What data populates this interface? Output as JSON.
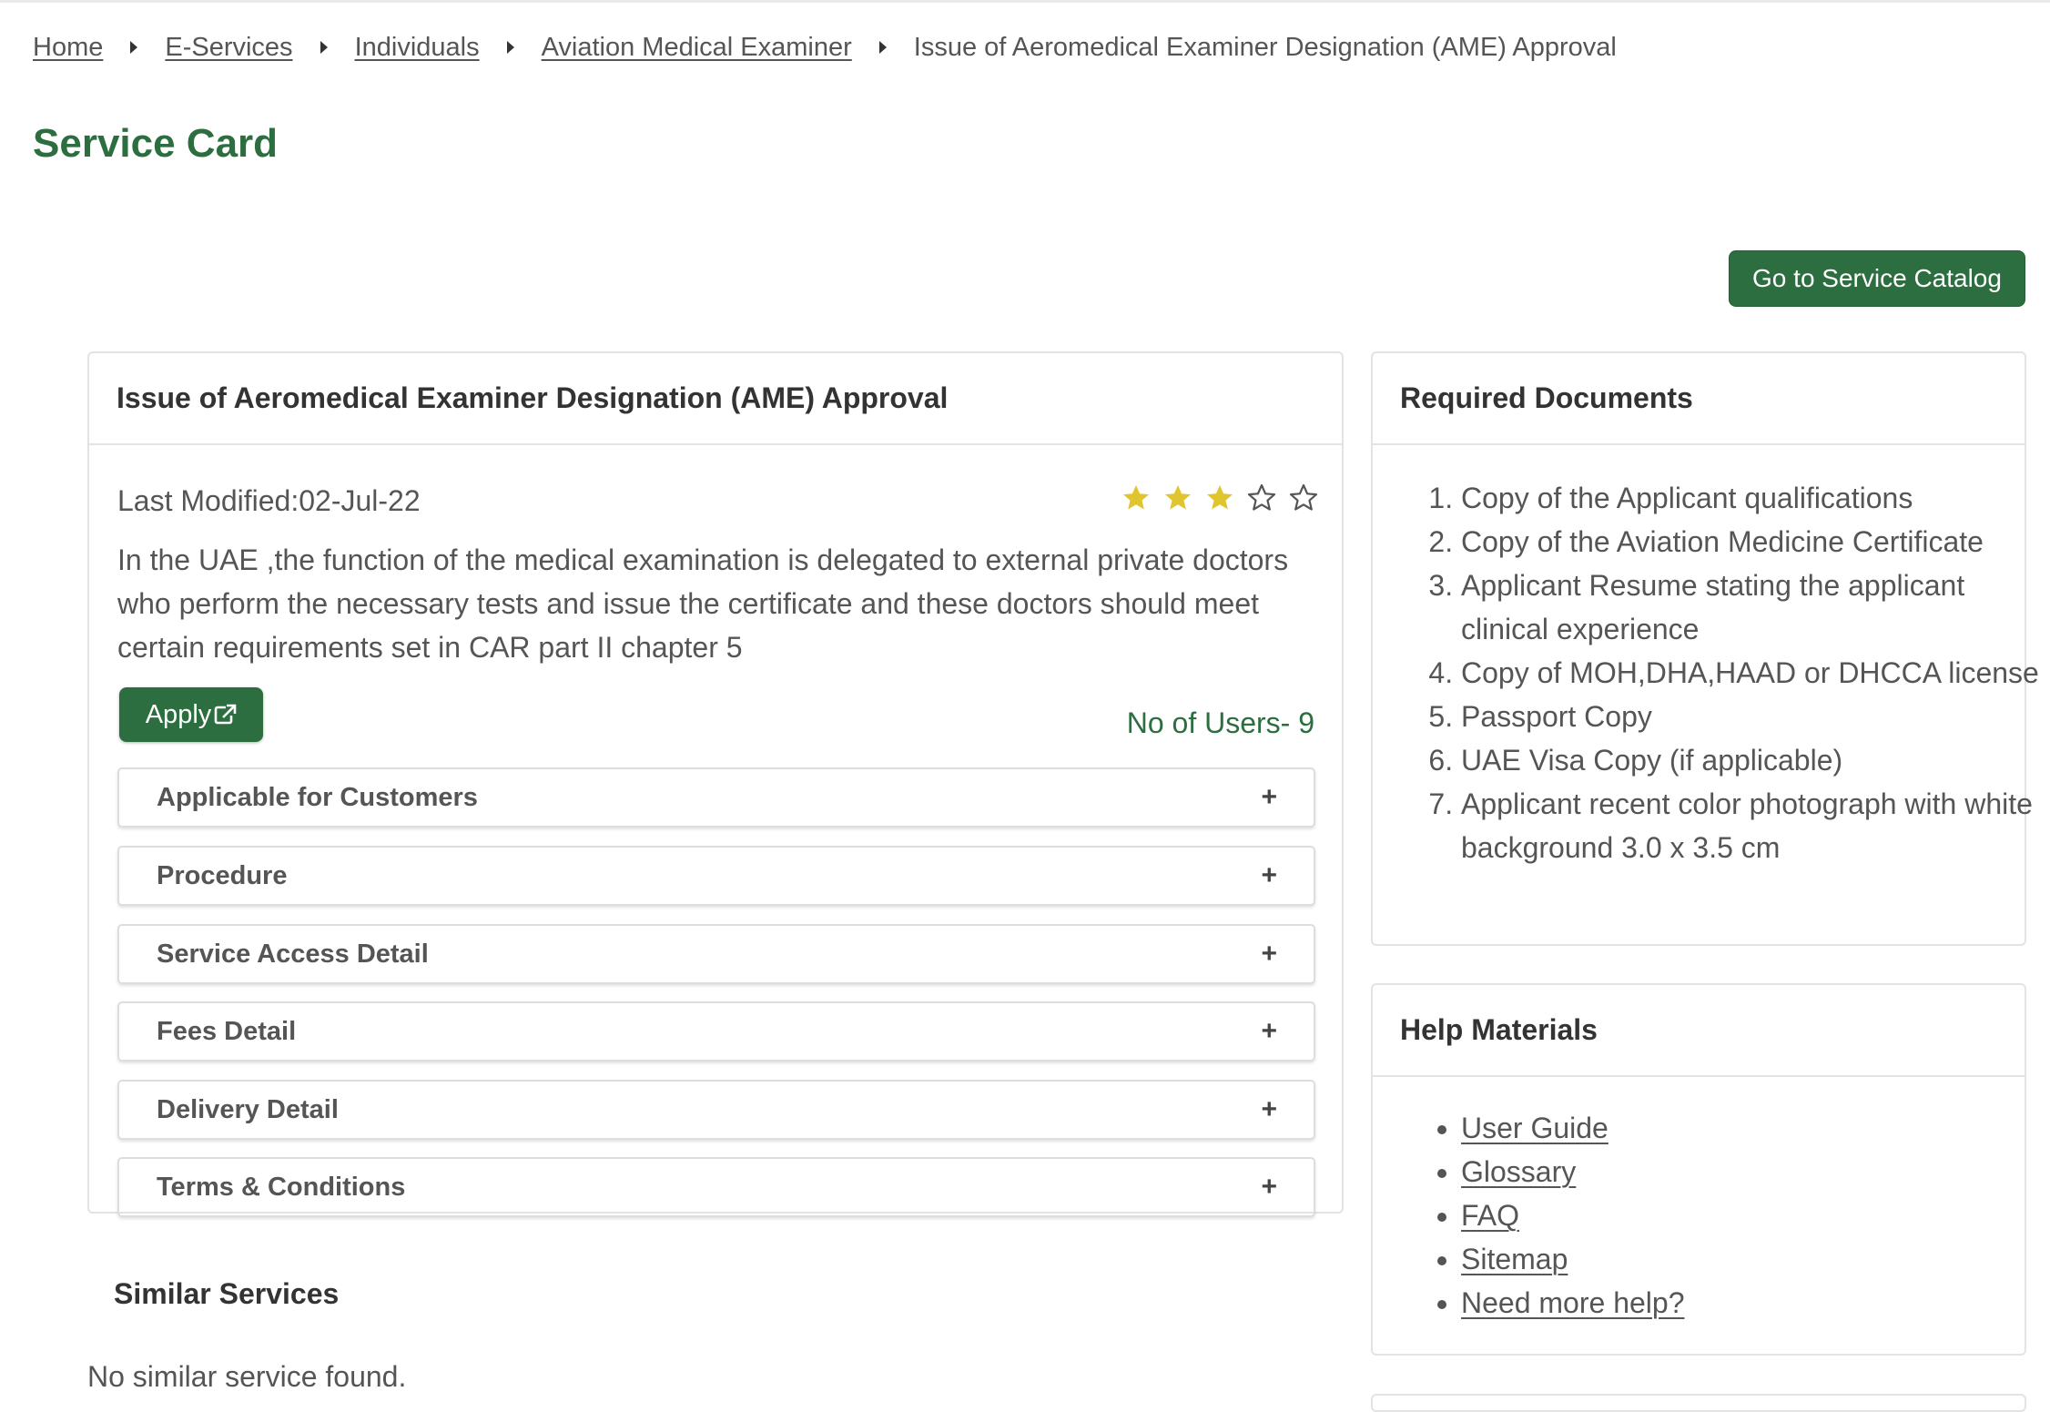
{
  "breadcrumb": {
    "items": [
      "Home",
      "E-Services",
      "Individuals",
      "Aviation Medical Examiner"
    ],
    "current": "Issue of Aeromedical Examiner Designation (AME) Approval"
  },
  "page_title": "Service Card",
  "catalog_button": "Go to Service Catalog",
  "service": {
    "title": "Issue of Aeromedical Examiner Designation (AME) Approval",
    "last_modified": "Last Modified:02-Jul-22",
    "rating": 3,
    "rating_max": 5,
    "description": "In the UAE ,the function of the medical examination is delegated to external private doctors who perform the necessary tests and issue the certificate and these doctors should meet certain requirements set in CAR part II chapter 5",
    "apply_label": "Apply",
    "users_text": "No of Users- 9",
    "accordion": [
      "Applicable for Customers",
      "Procedure",
      "Service Access Detail",
      "Fees Detail",
      "Delivery Detail",
      "Terms & Conditions"
    ],
    "accordion_symbol": "+"
  },
  "similar": {
    "title": "Similar Services",
    "empty": "No similar service found."
  },
  "documents": {
    "title": "Required Documents",
    "items": [
      "Copy of the Applicant qualifications",
      "Copy of the Aviation Medicine Certificate",
      "Applicant Resume stating the applicant clinical experience",
      "Copy of MOH,DHA,HAAD or DHCCA license",
      "Passport Copy",
      "UAE Visa Copy (if applicable)",
      "Applicant recent color photograph with white background 3.0 x 3.5 cm"
    ]
  },
  "help": {
    "title": "Help Materials",
    "items": [
      "User Guide",
      "Glossary",
      "FAQ",
      "Sitemap",
      "Need more help?"
    ]
  },
  "colors": {
    "brand_green": "#2c6e3f",
    "star_filled": "#e0c52e",
    "star_empty": "#555555"
  },
  "icons": {
    "breadcrumb_separator": "caret-right-icon",
    "apply": "external-link-icon",
    "star_filled": "star-filled-icon",
    "star_empty": "star-outline-icon"
  }
}
